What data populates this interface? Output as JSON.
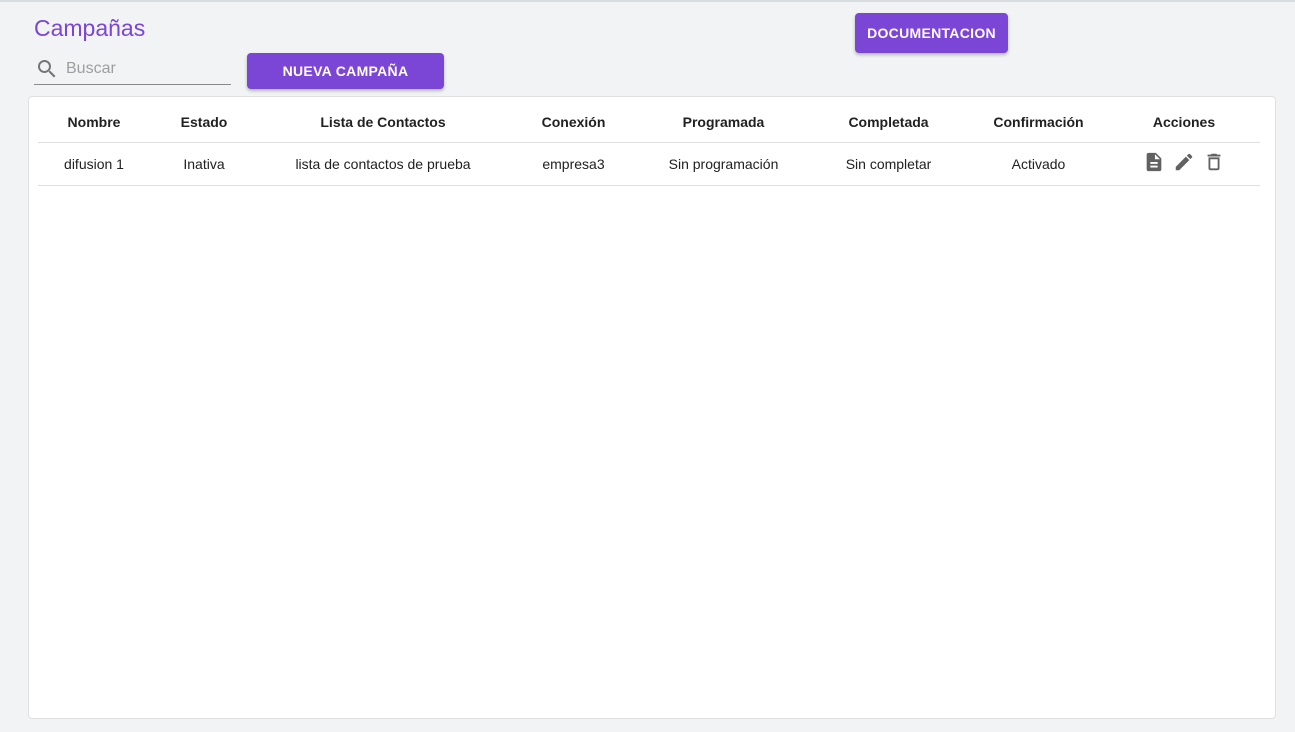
{
  "header": {
    "title": "Campañas",
    "documentation_label": "DOCUMENTACION"
  },
  "toolbar": {
    "search_placeholder": "Buscar",
    "search_value": "",
    "new_campaign_label": "NUEVA CAMPAÑA"
  },
  "table": {
    "columns": [
      "Nombre",
      "Estado",
      "Lista de Contactos",
      "Conexión",
      "Programada",
      "Completada",
      "Confirmación",
      "Acciones"
    ],
    "rows": [
      {
        "nombre": "difusion 1",
        "estado": "Inativa",
        "lista": "lista de contactos de prueba",
        "conexion": "empresa3",
        "programada": "Sin programación",
        "completada": "Sin completar",
        "confirmacion": "Activado",
        "actions": [
          "report-icon",
          "edit-icon",
          "delete-icon"
        ]
      }
    ]
  },
  "colors": {
    "accent": "#7b45d6",
    "icon": "#616161",
    "background": "#f1f3f4"
  }
}
